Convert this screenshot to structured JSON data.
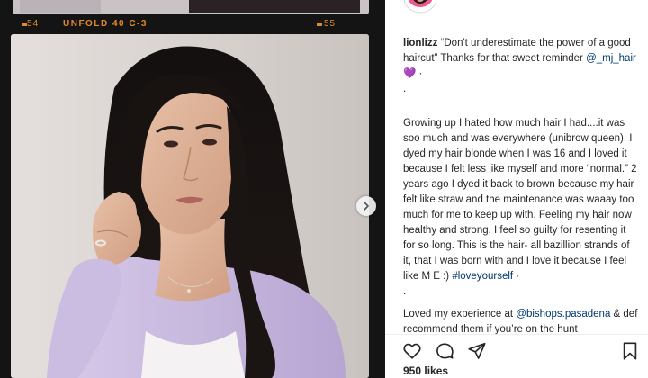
{
  "film": {
    "num_left": "54",
    "label": "UNFOLD 40 C-3",
    "num_right": "55"
  },
  "post": {
    "username": "lionlizz",
    "caption_intro": "“Don't underestimate the power of a good haircut” Thanks for that sweet reminder",
    "mention_1": "@_mj_hair",
    "heart_emoji": "💜",
    "dot_1": "·",
    "dot_2": ".",
    "body": "Growing up I hated how much hair I had....it was soo much and was everywhere (unibrow queen). I dyed my hair blonde when I was 16 and I loved it because I felt less like myself and more “normal.” 2 years ago I dyed it back to brown because my hair felt like straw and the maintenance was waaay too much for me to keep up with. Feeling my hair now healthy and strong, I feel so guilty for resenting it for so long. This is the hair- all bazillion strands of it, that I was born with and I love it because I feel like M E :)",
    "hashtag": "#loveyourself",
    "dot_3": "·",
    "dot_4": ".",
    "loved_prefix": "Loved my experience at",
    "mention_2": "@bishops.pasadena",
    "loved_suffix": "& def recommend them if you’re on the hunt",
    "likes": "950 likes"
  },
  "icons": {
    "like": "heart-icon",
    "comment": "comment-icon",
    "share": "share-icon",
    "save": "bookmark-icon",
    "next": "chevron-right-icon"
  },
  "colors": {
    "film_orange": "#e28a2b",
    "link_blue": "#00376b",
    "text": "#262626",
    "sweater": "#c3b1dc",
    "hair": "#1a1412"
  }
}
